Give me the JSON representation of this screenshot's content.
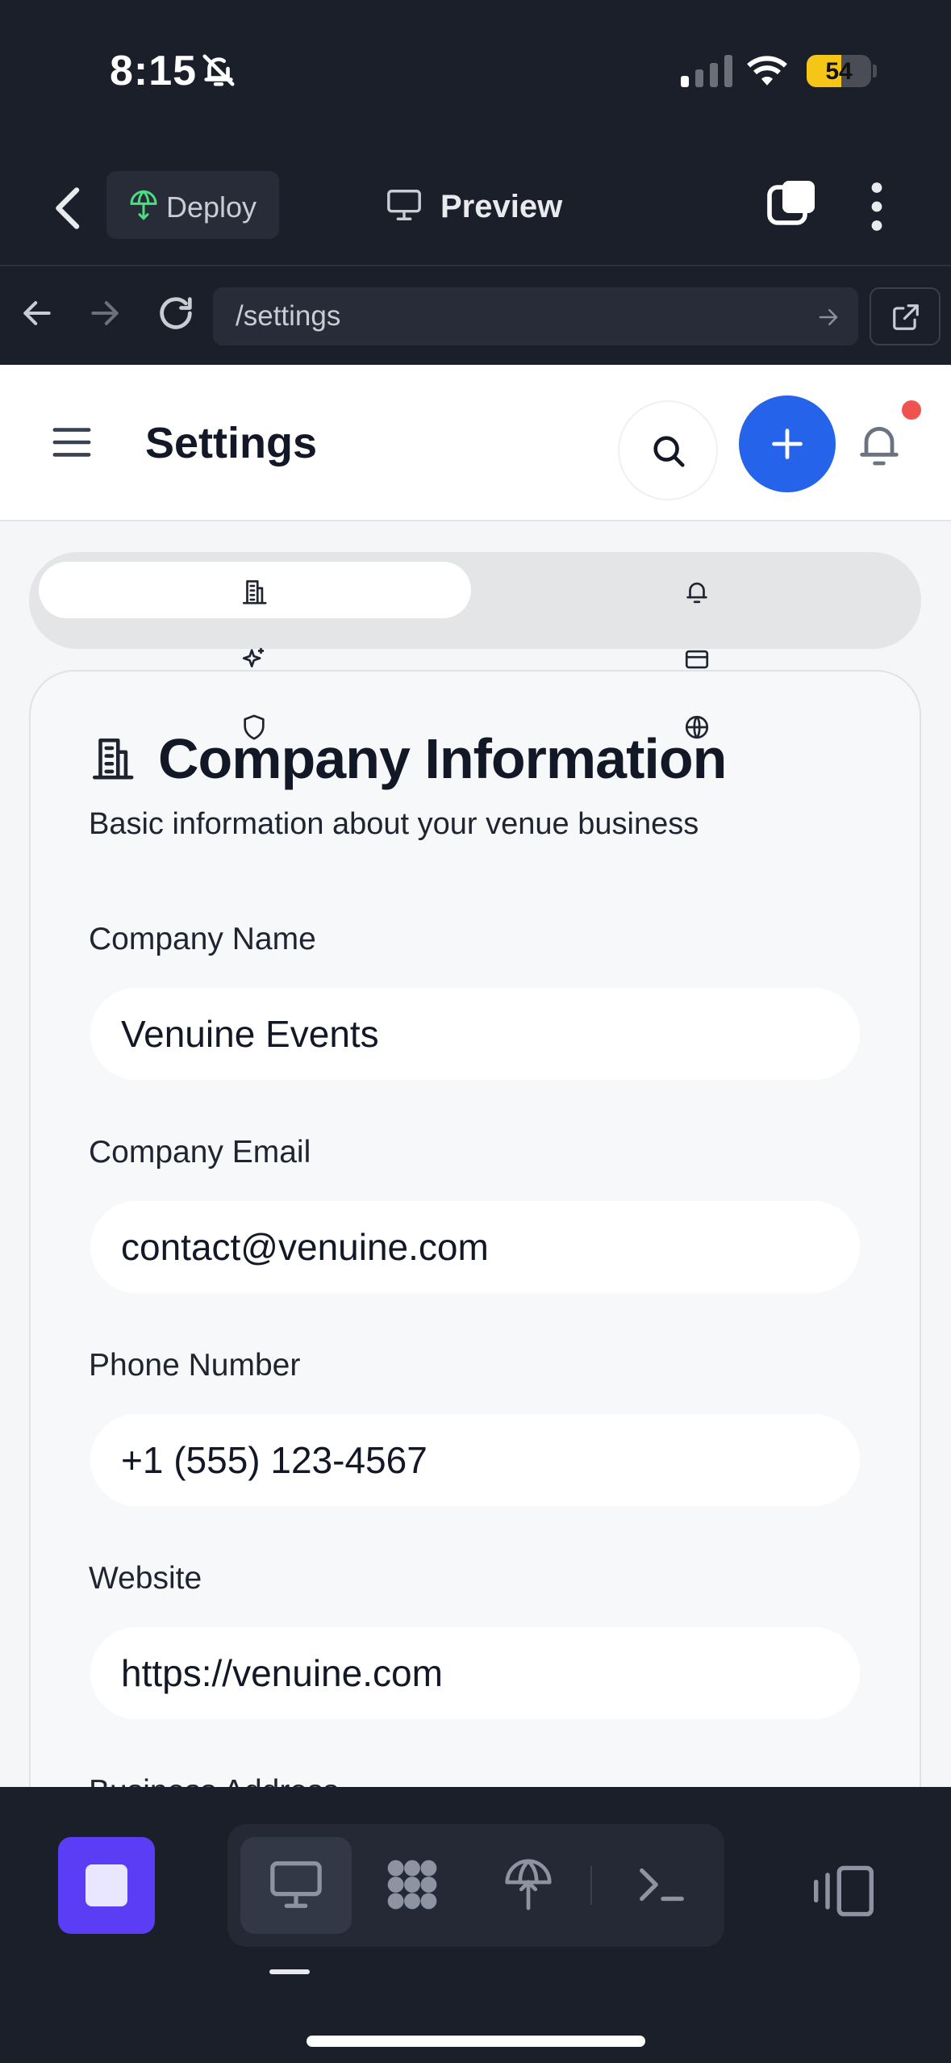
{
  "status_bar": {
    "time": "8:15",
    "battery_level": "54",
    "battery_fraction": 0.54
  },
  "editor_bar": {
    "deploy_label": "Deploy",
    "preview_label": "Preview"
  },
  "browser": {
    "url": "/settings"
  },
  "app_header": {
    "title": "Settings",
    "has_notification": true
  },
  "tabs": [
    {
      "icon": "building-icon",
      "active": true
    },
    {
      "icon": "bell-icon",
      "active": false
    },
    {
      "icon": "sparkles-icon",
      "active": false
    },
    {
      "icon": "credit-card-icon",
      "active": false
    },
    {
      "icon": "shield-icon",
      "active": false
    },
    {
      "icon": "globe-icon",
      "active": false
    }
  ],
  "card": {
    "title": "Company Information",
    "description": "Basic information about your venue business",
    "fields": [
      {
        "label": "Company Name",
        "value": "Venuine Events"
      },
      {
        "label": "Company Email",
        "value": "contact@venuine.com"
      },
      {
        "label": "Phone Number",
        "value": "+1 (555) 123-4567"
      },
      {
        "label": "Website",
        "value": "https://venuine.com"
      },
      {
        "label": "Business Address",
        "value": ""
      }
    ]
  },
  "colors": {
    "accent": "#2563eb",
    "notification": "#ef5350",
    "stop": "#5b3df5",
    "battery": "#f5c518"
  }
}
